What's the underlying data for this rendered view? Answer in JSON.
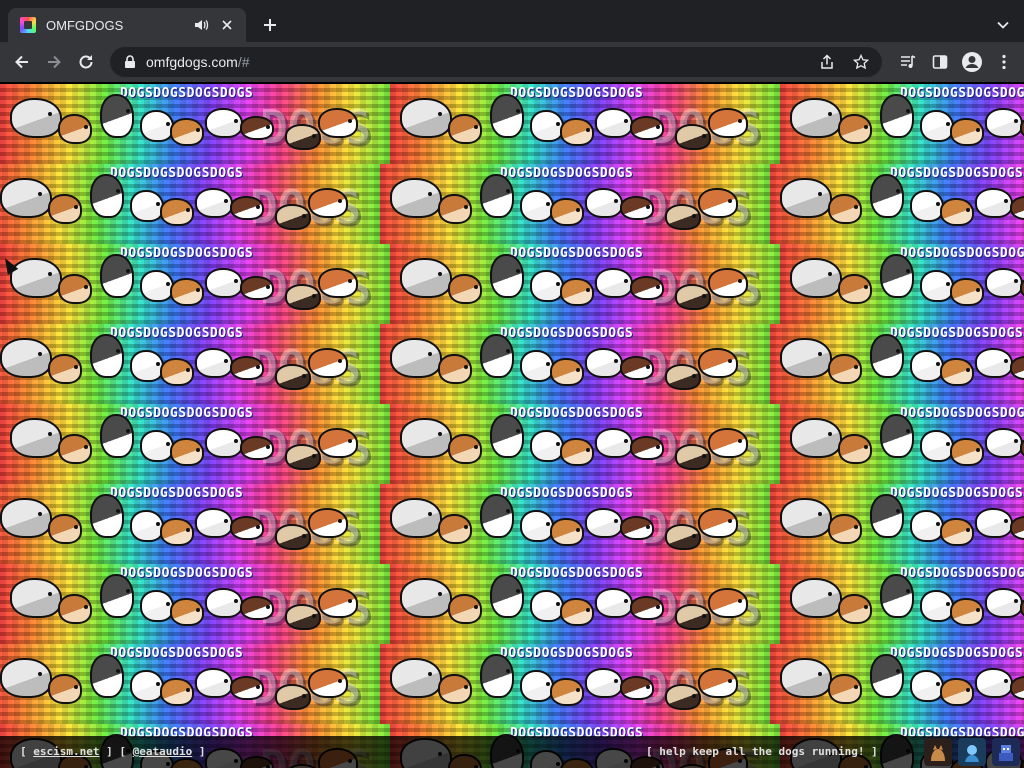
{
  "browser": {
    "tab": {
      "title": "OMFGDOGS"
    },
    "omnibox": {
      "host": "omfgdogs.com",
      "path": "/#"
    }
  },
  "page": {
    "tile_word": "DOGSDOGSDOGSDOGS",
    "tile_big": "DOGS"
  },
  "footer": {
    "left_open": "[ ",
    "link1": "escism.net",
    "mid": " ] [ ",
    "link2": "@eataudio",
    "left_close": " ]",
    "right_text": "[ help keep all the dogs running! ]"
  },
  "icons": {
    "favicon": "rainbow-dog-favicon",
    "audio": "speaker-icon",
    "close": "close-icon",
    "newtab": "plus-icon",
    "tabsearch": "chevron-down-icon",
    "back": "back-arrow-icon",
    "forward": "forward-arrow-icon",
    "reload": "reload-icon",
    "lock": "lock-icon",
    "share": "share-icon",
    "bookmark": "star-icon",
    "media": "media-controls-icon",
    "sidepanel": "side-panel-icon",
    "profile": "profile-icon",
    "menu": "kebab-menu-icon"
  },
  "colors": {
    "tabstrip_bg": "#202124",
    "toolbar_bg": "#35363a",
    "omnibox_bg": "#202124",
    "text": "#e8eaed"
  }
}
